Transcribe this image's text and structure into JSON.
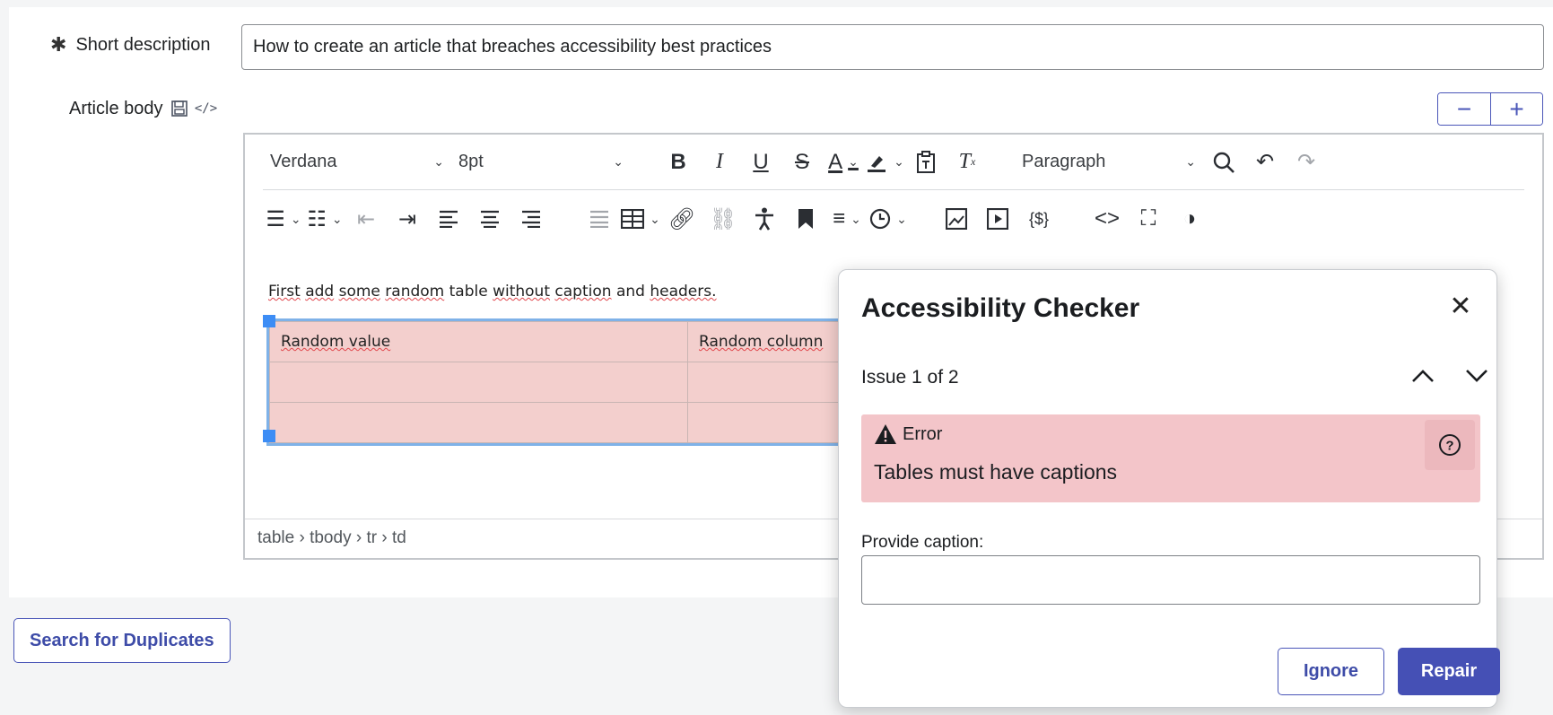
{
  "form": {
    "short_description_label": "Short description",
    "short_description_value": "How to create an article that breaches accessibility best practices",
    "article_body_label": "Article body"
  },
  "zoom": {
    "minus": "−",
    "plus": "+"
  },
  "toolbar": {
    "font_family": "Verdana",
    "font_size": "8pt",
    "block_format": "Paragraph"
  },
  "editor": {
    "paragraph_words": [
      "First",
      "add",
      "some",
      "random",
      "table",
      "without",
      "caption",
      "and",
      "headers."
    ],
    "table_rows": [
      [
        "Random value",
        "Random column"
      ],
      [
        "",
        ""
      ],
      [
        "",
        ""
      ]
    ],
    "statusbar_path": "table › tbody › tr › td"
  },
  "duplicates_button": "Search for Duplicates",
  "dialog": {
    "title": "Accessibility Checker",
    "issue_count": "Issue 1 of 2",
    "severity": "Error",
    "message": "Tables must have captions",
    "caption_label": "Provide caption:",
    "caption_value": "",
    "ignore_label": "Ignore",
    "repair_label": "Repair"
  },
  "colors": {
    "accent": "#4550b5",
    "error_bg": "#f3c5c9",
    "table_cell_bg": "#f3cfcd",
    "selection_handle": "#3d8df5"
  }
}
